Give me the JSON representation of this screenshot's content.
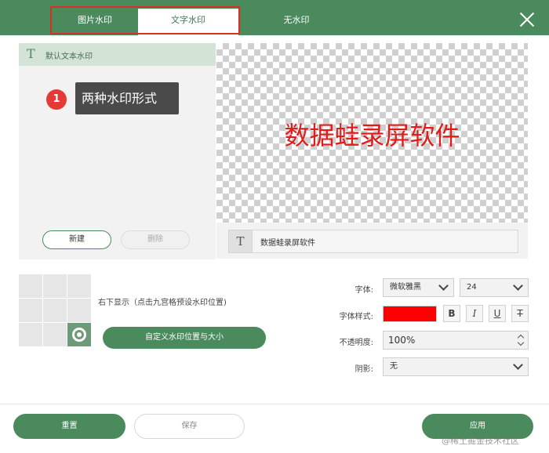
{
  "tabs": [
    {
      "label": "图片水印",
      "active": false
    },
    {
      "label": "文字水印",
      "active": true
    },
    {
      "label": "无水印",
      "active": false
    }
  ],
  "left_panel": {
    "icon": "text-t-icon",
    "title": "默认文本水印",
    "new_label": "新建",
    "delete_label": "删除"
  },
  "annotation": {
    "number": "1",
    "text": "两种水印形式"
  },
  "preview": {
    "text": "数据蛙录屏软件",
    "text_color": "#e21b1b"
  },
  "text_input": {
    "icon": "text-t-icon",
    "value": "数据蛙录屏软件"
  },
  "position": {
    "label": "右下显示（点击九宫格预设水印位置)",
    "selected_cell": 8,
    "custom_button": "自定义水印位置与大小"
  },
  "settings": {
    "font_label": "字体:",
    "font_value": "微软雅黑",
    "size_value": "24",
    "style_label": "字体样式:",
    "color": "#ff0000",
    "style_buttons": [
      "B",
      "I",
      "U",
      "T"
    ],
    "opacity_label": "不透明度:",
    "opacity_value": "100%",
    "shadow_label": "阴影:",
    "shadow_value": "无"
  },
  "footer": {
    "reset_label": "重置",
    "save_label": "保存",
    "apply_label": "应用"
  },
  "credit": "@稀土掘金技术社区",
  "colors": {
    "brand_green": "#4a8a5c",
    "highlight_red": "#d93025"
  }
}
